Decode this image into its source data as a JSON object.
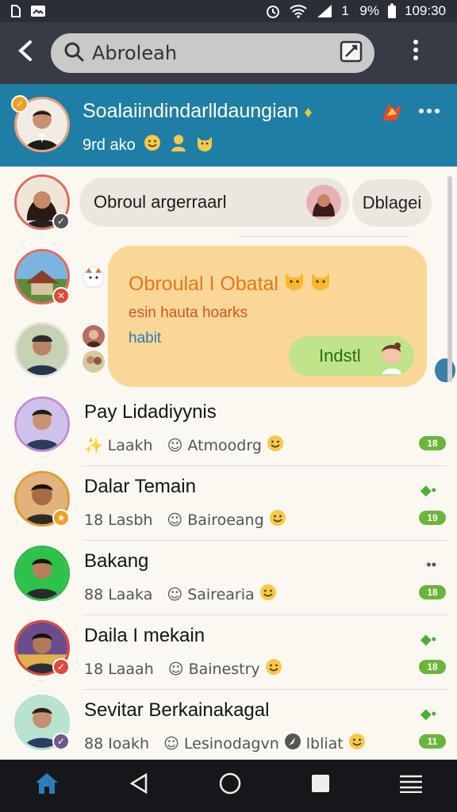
{
  "status_bar": {
    "battery": "19%",
    "time": "109:30"
  },
  "appbar": {
    "search_query": "Abroleah"
  },
  "group": {
    "title": "Soalaiindindarlldaungian",
    "subtitle": "9rd ako",
    "accent": "#1f7ea6"
  },
  "messages": {
    "grey_bubble": "Obroul argerraarl",
    "grey_bubble2": "Dblagei",
    "yellow_title": "Obroulal I Obatal",
    "yellow_line2": "esin hauta hoarks",
    "yellow_line3": "habit",
    "green_bubble": "Indstl"
  },
  "chats": [
    {
      "name": "Pay Lidadiyynis",
      "count": "",
      "preview_a": "Laakh",
      "preview_b": "Atmoodrg",
      "pill": "18"
    },
    {
      "name": "Dalar Temain",
      "count": "18",
      "preview_a": "Lasbh",
      "preview_b": "Bairoeang",
      "pill": "19"
    },
    {
      "name": "Bakang",
      "count": "88",
      "preview_a": "Laaka",
      "preview_b": "Sairearia",
      "pill": "18"
    },
    {
      "name": "Daila I mekain",
      "count": "18",
      "preview_a": "Laaah",
      "preview_b": "Bainestry",
      "pill": "18"
    },
    {
      "name": "Sevitar Berkainakagal",
      "count": "88",
      "preview_a": "Ioakh",
      "preview_b": "Lesinodagvn",
      "preview_c": "lbliat",
      "pill": "11"
    }
  ],
  "colors": {
    "status_bar": "#2a2e36",
    "app_bar": "#363b45",
    "header": "#1f7ea6",
    "bubble_yellow": "#fbd797",
    "bubble_green": "#bfe48a",
    "nav": "#15171b"
  },
  "icons": [
    "back-arrow-icon",
    "search-icon",
    "edit-icon",
    "more-vert-icon",
    "home-icon",
    "back-nav-icon",
    "home-nav-icon",
    "recents-nav-icon",
    "menu-nav-icon"
  ]
}
